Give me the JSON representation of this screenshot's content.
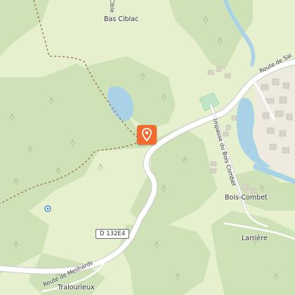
{
  "map": {
    "colors": {
      "forest": "#cfe2b7",
      "meadow": "#e6f0cf",
      "water": "#a9d2e7",
      "road": "#ffffff",
      "road_outline": "#c9c9c9",
      "trail": "#9a7a4c",
      "building": "#d9d4c8",
      "marker": "#f26a2e"
    },
    "places": {
      "bas_ciblac": "Bas Ciblac",
      "bois_combet": "Bois-Combet",
      "larriere": "Larrière",
      "tralourieux": "Tralourieux"
    },
    "roads": {
      "route_de_sai": "Route de Sai",
      "impasse_bois_combet": "Impasse du Bois Combet",
      "route_de_meilhards": "Route de Meilhards",
      "d132e4": "D 132E4",
      "top_edge_partial": "Cible"
    },
    "marker_icon": "location-pin-icon"
  }
}
